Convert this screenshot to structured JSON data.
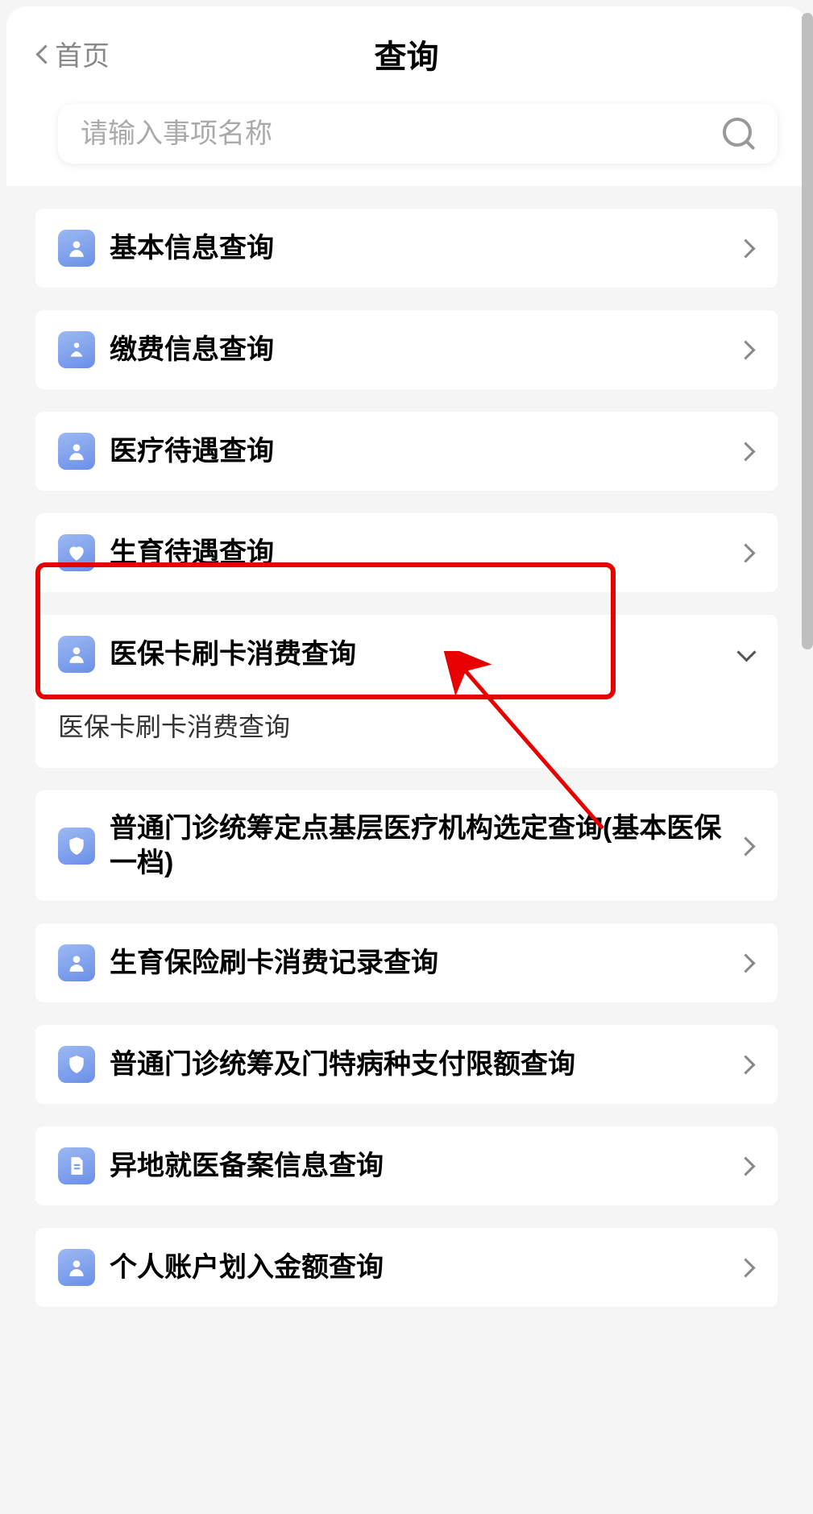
{
  "header": {
    "back_label": "首页",
    "title": "查询"
  },
  "search": {
    "placeholder": "请输入事项名称"
  },
  "items": [
    {
      "label": "基本信息查询",
      "icon": "person",
      "expanded": false
    },
    {
      "label": "缴费信息查询",
      "icon": "hand",
      "expanded": false
    },
    {
      "label": "医疗待遇查询",
      "icon": "person",
      "expanded": false
    },
    {
      "label": "生育待遇查询",
      "icon": "heart",
      "expanded": false
    },
    {
      "label": "医保卡刷卡消费查询",
      "icon": "person",
      "expanded": true,
      "sub": "医保卡刷卡消费查询"
    },
    {
      "label": "普通门诊统筹定点基层医疗机构选定查询(基本医保一档)",
      "icon": "shield",
      "expanded": false
    },
    {
      "label": "生育保险刷卡消费记录查询",
      "icon": "person",
      "expanded": false
    },
    {
      "label": "普通门诊统筹及门特病种支付限额查询",
      "icon": "shield",
      "expanded": false
    },
    {
      "label": "异地就医备案信息查询",
      "icon": "doc",
      "expanded": false
    },
    {
      "label": "个人账户划入金额查询",
      "icon": "person",
      "expanded": false
    }
  ],
  "annotation": {
    "highlight_index": 4
  }
}
